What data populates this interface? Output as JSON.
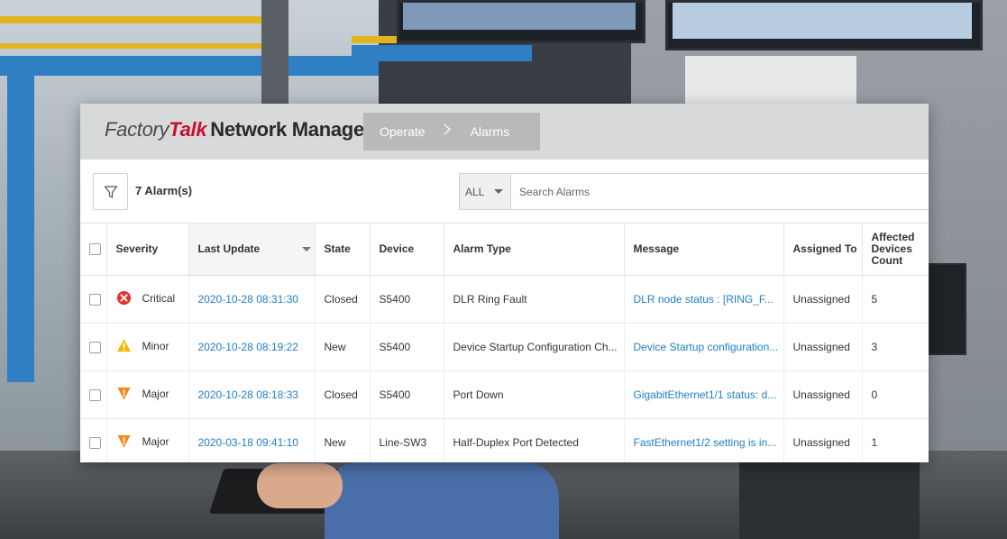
{
  "app": {
    "brand_factory": "Factory",
    "brand_talk": "Talk",
    "brand_product": "Network Manager"
  },
  "breadcrumb": {
    "items": [
      "Operate",
      "Alarms"
    ]
  },
  "toolbar": {
    "alarm_count": "7 Alarm(s)",
    "scope_value": "ALL",
    "search_placeholder": "Search Alarms"
  },
  "table": {
    "headers": {
      "severity": "Severity",
      "last_update": "Last Update",
      "state": "State",
      "device": "Device",
      "alarm_type": "Alarm Type",
      "message": "Message",
      "assigned_to": "Assigned To",
      "affected_devices": "Affected Devices Count"
    },
    "rows": [
      {
        "severity": "Critical",
        "severity_icon": "critical-icon",
        "last_update": "2020-10-28 08:31:30",
        "state": "Closed",
        "device": "S5400",
        "alarm_type": "DLR Ring Fault",
        "message": "DLR node status : [RING_F...",
        "assigned_to": "Unassigned",
        "affected": "5"
      },
      {
        "severity": "Minor",
        "severity_icon": "minor-warning-icon",
        "last_update": "2020-10-28 08:19:22",
        "state": "New",
        "device": "S5400",
        "alarm_type": "Device Startup Configuration Ch...",
        "message": "Device Startup configuration...",
        "assigned_to": "Unassigned",
        "affected": "3"
      },
      {
        "severity": "Major",
        "severity_icon": "major-icon",
        "last_update": "2020-10-28 08:18:33",
        "state": "Closed",
        "device": "S5400",
        "alarm_type": "Port Down",
        "message": "GigabitEthernet1/1 status: d...",
        "assigned_to": "Unassigned",
        "affected": "0"
      },
      {
        "severity": "Major",
        "severity_icon": "major-icon",
        "last_update": "2020-03-18 09:41:10",
        "state": "New",
        "device": "Line-SW3",
        "alarm_type": "Half-Duplex Port Detected",
        "message": "FastEthernet1/2 setting is in...",
        "assigned_to": "Unassigned",
        "affected": "1"
      }
    ]
  },
  "colors": {
    "critical": "#e5322d",
    "minor": "#f2b705",
    "major": "#f08a1c",
    "link": "#1f7ec8",
    "brand_red": "#c8102e"
  }
}
